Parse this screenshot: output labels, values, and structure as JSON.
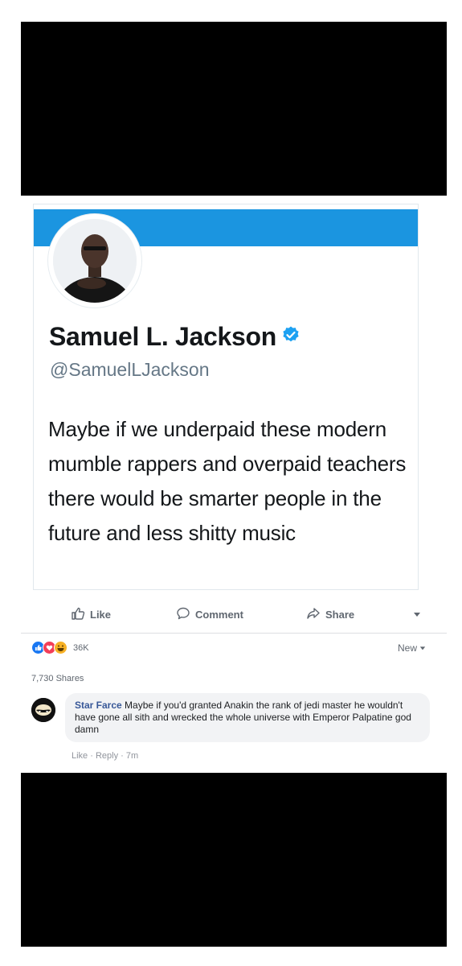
{
  "tweet": {
    "display_name": "Samuel L. Jackson",
    "handle": "@SamuelLJackson",
    "text": "Maybe if we underpaid these modern mumble rappers and overpaid teachers there would be smarter people in the future and less shitty music"
  },
  "actions": {
    "like": "Like",
    "comment": "Comment",
    "share": "Share"
  },
  "reactions": {
    "count": "36K",
    "sort": "New"
  },
  "shares": "7,730 Shares",
  "comment": {
    "author": "Star Farce",
    "text": "Maybe if you'd granted Anakin the rank of jedi master he wouldn't have gone all sith and wrecked the whole universe with Emperor Palpatine god damn",
    "like": "Like",
    "separator": "·",
    "reply": "Reply",
    "time": "7m"
  },
  "colors": {
    "twitter_blue": "#1b95e0",
    "fb_link": "#385898",
    "text_secondary": "#606770"
  },
  "icons": [
    "verified-icon",
    "thumbs-up-icon",
    "comment-icon",
    "share-arrow-icon",
    "chevron-down-icon",
    "like-reaction-icon",
    "love-reaction-icon",
    "haha-reaction-icon"
  ]
}
